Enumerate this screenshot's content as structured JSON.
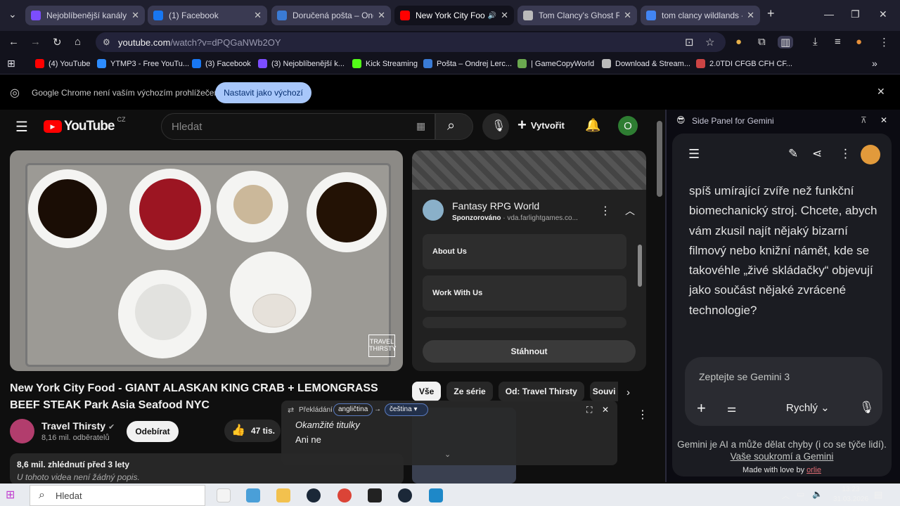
{
  "tabs": [
    {
      "title": "Nejoblíbenější kanály - T",
      "active": false,
      "fav": "#7c4dff"
    },
    {
      "title": "(1) Facebook",
      "active": false,
      "fav": "#1877f2"
    },
    {
      "title": "Doručená pošta – Ondre",
      "active": false,
      "fav": "#3a7bd5"
    },
    {
      "title": "New York City Food",
      "active": true,
      "fav": "#ff0000"
    },
    {
      "title": "Tom Clancy's Ghost Rec",
      "active": false,
      "fav": "#bbbbbb"
    },
    {
      "title": "tom clancy wildlands - ",
      "active": false,
      "fav": "#4285f4"
    }
  ],
  "address": {
    "host": "youtube.com",
    "path": "/watch?v=dPQGaNWb2OY"
  },
  "bookmarks": [
    {
      "label": "(4) YouTube",
      "fav": "#ff0000"
    },
    {
      "label": "YTMP3 - Free YouTu...",
      "fav": "#2d8cff"
    },
    {
      "label": "(3) Facebook",
      "fav": "#1877f2"
    },
    {
      "label": "(3) Nejoblíbenější k...",
      "fav": "#7c4dff"
    },
    {
      "label": "Kick Streaming",
      "fav": "#53fc18"
    },
    {
      "label": "Pošta – Ondrej Lerc...",
      "fav": "#3a7bd5"
    },
    {
      "label": "| GameCopyWorld",
      "fav": "#6aa84f"
    },
    {
      "label": "Download & Stream...",
      "fav": "#bbbbbb"
    },
    {
      "label": "2.0TDI CFGB CFH CF...",
      "fav": "#cc4444"
    }
  ],
  "infobar": {
    "message": "Google Chrome není vaším výchozím prohlížečem",
    "button": "Nastavit jako výchozí"
  },
  "youtube": {
    "logo": "YouTube",
    "region": "CZ",
    "search_placeholder": "Hledat",
    "create": "Vytvořit",
    "avatar_letter": "O",
    "video_title": "New York City Food - GIANT ALASKAN KING CRAB + LEMONGRASS BEEF STEAK Park Asia Seafood NYC",
    "watermark": "TRAVEL THIRSTY",
    "channel": "Travel Thirsty",
    "subscribers": "8,16 mil. odběratelů",
    "subscribe": "Odebírat",
    "likes": "47 tis.",
    "views": "8,6 mil. zhlédnutí  před 3 lety",
    "no_desc": "U tohoto videa není žádný popis."
  },
  "ad": {
    "name": "Fantasy RPG World",
    "sponsored": "Sponzorováno",
    "domain": "vda.farlightgames.co...",
    "rows": [
      "About Us",
      "Work With Us"
    ],
    "download": "Stáhnout"
  },
  "chips": [
    "Vše",
    "Ze série",
    "Od: Travel Thirsty",
    "Souvi"
  ],
  "translate": {
    "label": "Překládání",
    "from": "angličtina",
    "to": "čeština",
    "line1": "Okamžité titulky",
    "line2": "Ani ne"
  },
  "gemini": {
    "panel_title": "Side Panel for Gemini",
    "response": "spíš umírající zvíře než funkční biomechanický stroj. Chcete, abych vám zkusil najít nějaký bizarní filmový nebo knižní námět, kde se takovéhle „živé skládačky“ objevují jako součást nějaké zvrácené technologie?",
    "input_placeholder": "Zeptejte se Gemini 3",
    "mode": "Rychlý",
    "disclaimer": "Gemini je AI a může dělat chyby (i co se týče lidí).",
    "privacy": "Vaše soukromí a Gemini",
    "made_with": "Made with love by",
    "author": "orlie"
  },
  "taskbar": {
    "search": "Hledat",
    "time": "13:23",
    "date": "31.03.2026"
  }
}
